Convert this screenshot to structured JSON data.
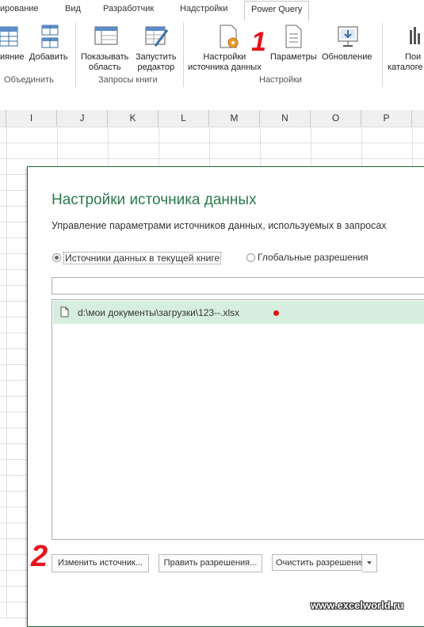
{
  "ribbon_tabs": [
    "ирование",
    "Вид",
    "Разработчик",
    "Надстройки",
    "Power Query"
  ],
  "ribbon": {
    "btn_combine": "ияние",
    "btn_append": "Добавить",
    "group_combine": "Объединить",
    "btn_show_pane": [
      "Показывать",
      "область"
    ],
    "btn_launch_editor": [
      "Запустить",
      "редактор"
    ],
    "group_workbook_queries": "Запросы книги",
    "btn_data_source_settings": [
      "Настройки",
      "источника данных"
    ],
    "btn_options": "Параметры",
    "btn_update": "Обновление",
    "group_settings": "Настройки",
    "btn_catalog": [
      "Пои",
      "каталоге"
    ]
  },
  "annotations": {
    "one": "1",
    "two": "2"
  },
  "columns": [
    "I",
    "J",
    "K",
    "L",
    "M",
    "N",
    "O",
    "P"
  ],
  "dialog": {
    "title": "Настройки источника данных",
    "description": "Управление параметрами источников данных, используемых в запросах",
    "radio_current": "Источники данных в текущей книге",
    "radio_global": "Глобальные разрешения",
    "search_value": "",
    "sources": [
      "d:\\мои документы\\загрузки\\123--.xlsx"
    ],
    "btn_change_source": "Изменить источник...",
    "btn_edit_permissions": "Править разрешения...",
    "btn_clear_permissions": "Очистить разрешения"
  },
  "watermark": "www.excelworld.ru",
  "colors": {
    "accent_green": "#2b7a4b",
    "selection": "#d6eede",
    "annotation_red": "#e8121b"
  }
}
